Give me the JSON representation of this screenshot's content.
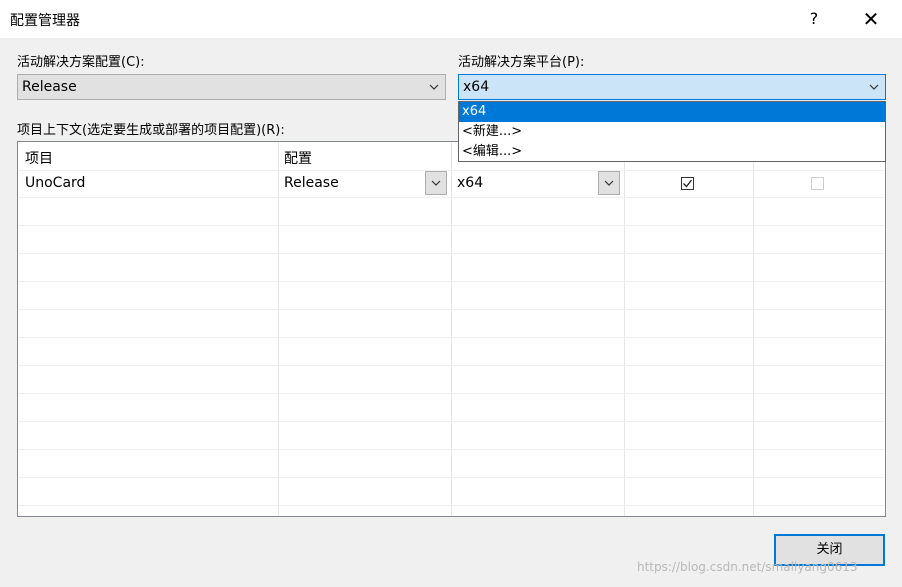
{
  "window": {
    "title": "配置管理器",
    "help_label": "?",
    "close_label": "✕"
  },
  "solution_config": {
    "label": "活动解决方案配置(C):",
    "value": "Release"
  },
  "solution_platform": {
    "label": "活动解决方案平台(P):",
    "value": "x64",
    "options": [
      "x64",
      "<新建...>",
      "<编辑...>"
    ],
    "selected_index": 0
  },
  "project_context": {
    "label": "项目上下文(选定要生成或部署的项目配置)(R):",
    "columns": [
      "项目",
      "配置",
      "",
      "",
      ""
    ],
    "rows": [
      {
        "project": "UnoCard",
        "configuration": "Release",
        "platform": "x64",
        "build": true,
        "deploy": false,
        "deploy_enabled": false
      }
    ]
  },
  "buttons": {
    "close": "关闭"
  },
  "watermark": "https://blog.csdn.net/smallyang0613"
}
